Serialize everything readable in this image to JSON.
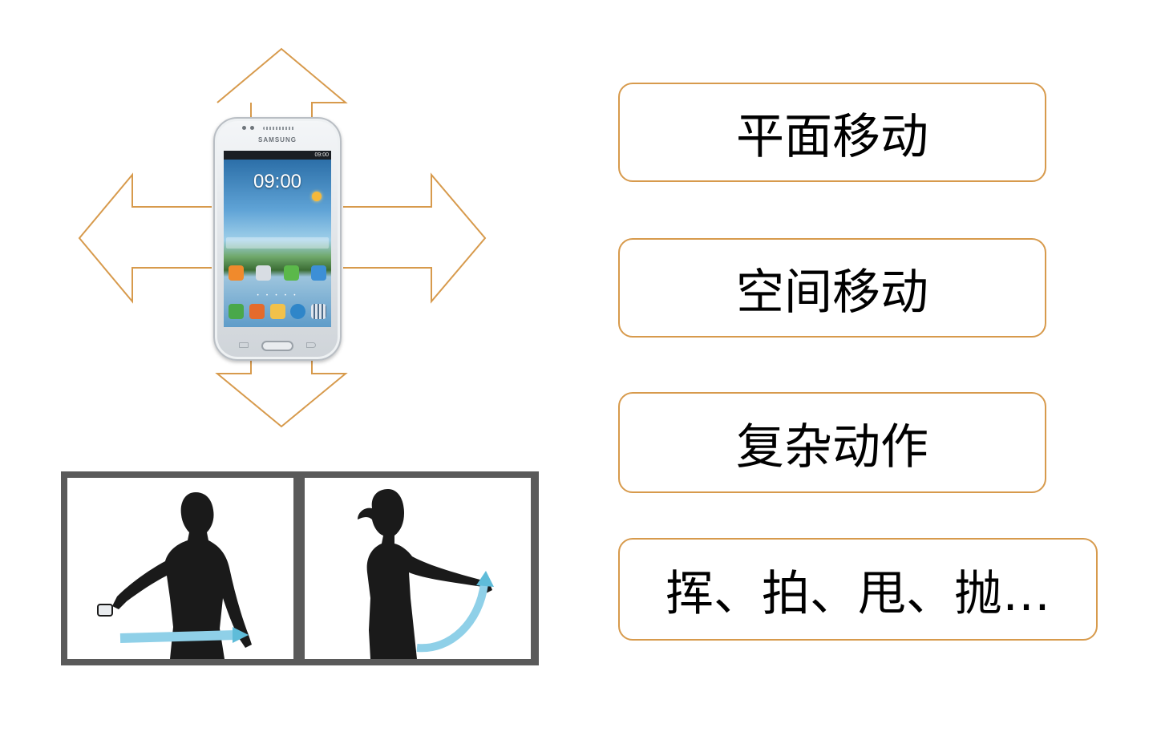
{
  "diagram": {
    "phone": {
      "brand": "SAMSUNG",
      "status_time": "09:00",
      "clock": "09:00"
    },
    "arrow_color": "#d79a4c",
    "box_border_color": "#d79a4c",
    "motion_types": [
      {
        "label": "平面移动"
      },
      {
        "label": "空间移动"
      },
      {
        "label": "复杂动作"
      },
      {
        "label": "挥、拍、甩、抛…"
      }
    ],
    "gesture_panels": [
      {
        "name": "front-view-swing"
      },
      {
        "name": "side-view-swing"
      }
    ],
    "gesture_trail_color": "#8fd0e8",
    "silhouette_color": "#1a1a1a"
  }
}
